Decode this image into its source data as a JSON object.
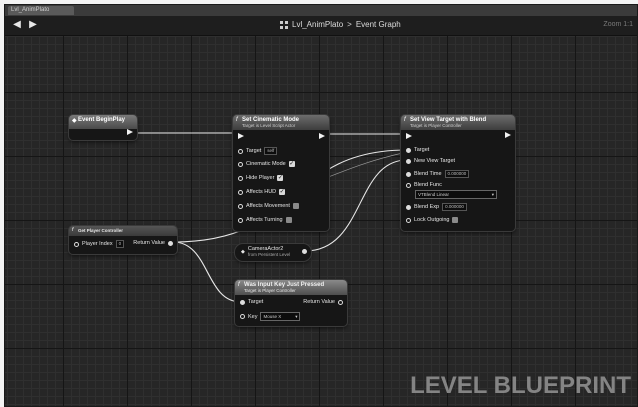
{
  "tab": {
    "label": "Lvl_AnimPlato"
  },
  "toolbar": {
    "back_icon": "back-arrow-icon",
    "forward_icon": "forward-arrow-icon",
    "crumb_level": "Lvl_AnimPlato",
    "crumb_separator": ">",
    "crumb_graph": "Event Graph",
    "zoom": "Zoom 1:1"
  },
  "nodes": {
    "begin_play": {
      "title": "Event BeginPlay"
    },
    "cinematic": {
      "title": "Set Cinematic Mode",
      "subtitle": "Target is Level Script Actor",
      "target_label": "Target",
      "target_value": "self",
      "pins": [
        "Cinematic Mode",
        "Hide Player",
        "Affects HUD",
        "Affects Movement",
        "Affects Turning"
      ]
    },
    "view_target": {
      "title": "Set View Target with Blend",
      "subtitle": "Target is Player Controller",
      "target_label": "Target",
      "new_view_target_label": "New View Target",
      "blend_time_label": "Blend Time",
      "blend_time_value": "0.000000",
      "blend_func_label": "Blend Func",
      "blend_func_value": "VTBlend Linear",
      "blend_exp_label": "Blend Exp",
      "blend_exp_value": "0.000000",
      "lock_outgoing_label": "Lock Outgoing"
    },
    "get_player": {
      "title": "Get Player Controller",
      "player_index_label": "Player Index",
      "player_index_value": "0",
      "return_label": "Return Value"
    },
    "camera_ref": {
      "title": "CameraActor2",
      "subtitle": "from Persistent Level"
    },
    "input_key": {
      "title": "Was Input Key Just Pressed",
      "subtitle": "Target is Player Controller",
      "target_label": "Target",
      "return_label": "Return Value",
      "key_label": "Key",
      "key_value": "Mouse X"
    }
  },
  "watermark": "LEVEL BLUEPRINT",
  "colors": {
    "canvas": "#262626",
    "node_body": "#161616",
    "wire": "#e8e8e8",
    "watermark": "#8a8a8a"
  }
}
